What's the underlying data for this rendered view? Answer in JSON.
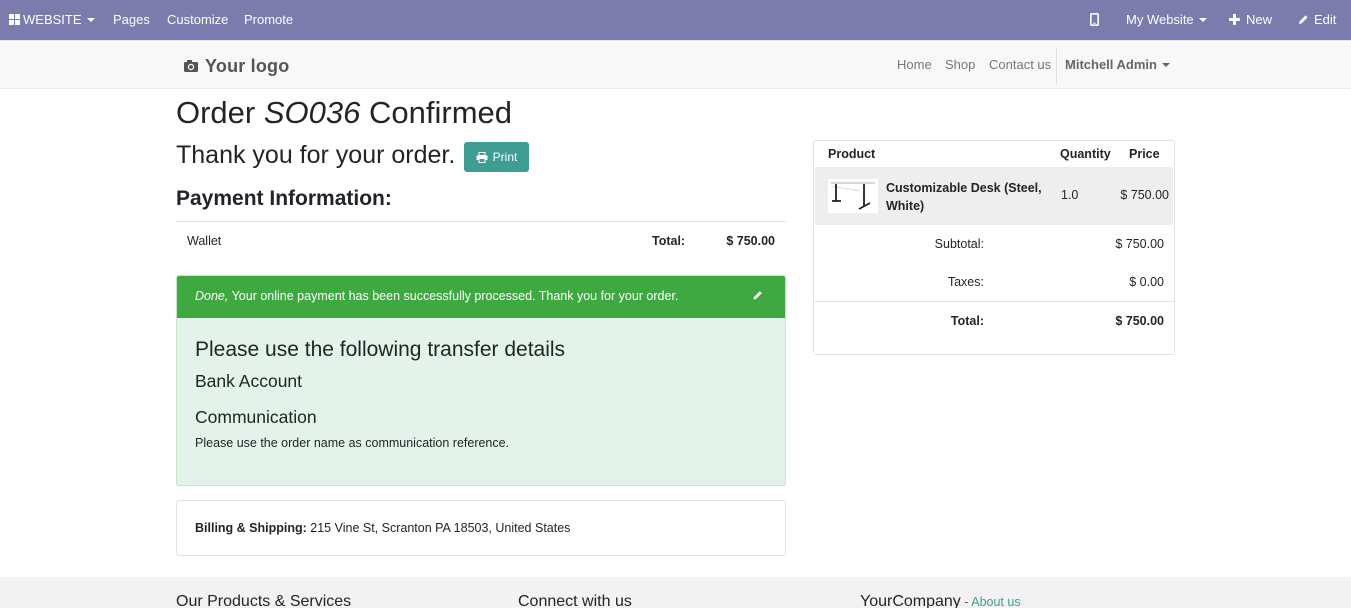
{
  "adminbar": {
    "website_label": "WEBSITE",
    "pages_label": "Pages",
    "customize_label": "Customize",
    "promote_label": "Promote",
    "mywebsite_label": "My Website",
    "new_label": "New",
    "edit_label": "Edit",
    "bg_color": "#7c7bad"
  },
  "header": {
    "logo_text": "Your logo",
    "nav": [
      "Home",
      "Shop",
      "Contact us"
    ],
    "user_label": "Mitchell Admin"
  },
  "order": {
    "title_prefix": "Order",
    "order_ref": "SO036",
    "title_suffix": "Confirmed",
    "thanks": "Thank you for your order.",
    "print_label": "Print",
    "payment_heading": "Payment Information:",
    "payment_method": "Wallet",
    "total_label": "Total:",
    "total_value": "$ 750.00"
  },
  "alert": {
    "status_word": "Done,",
    "message": "Your online payment has been successfully processed. Thank you for your order.",
    "transfer_heading": "Please use the following transfer details",
    "bank_account_label": "Bank Account",
    "communication_label": "Communication",
    "communication_note": "Please use the order name as communication reference.",
    "header_color": "#3ea940",
    "body_color": "#e4f3ea"
  },
  "billing": {
    "label": "Billing & Shipping:",
    "address": "215 Vine St, Scranton PA 18503, United States"
  },
  "summary": {
    "col_product": "Product",
    "col_quantity": "Quantity",
    "col_price": "Price",
    "items": [
      {
        "name": "Customizable Desk (Steel, White)",
        "quantity": "1.0",
        "price": "$ 750.00"
      }
    ],
    "subtotal_label": "Subtotal:",
    "subtotal_value": "$ 750.00",
    "taxes_label": "Taxes:",
    "taxes_value": "$ 0.00",
    "total_label": "Total:",
    "total_value": "$ 750.00"
  },
  "footer": {
    "col1": "Our Products & Services",
    "col2": "Connect with us",
    "col3": "YourCompany",
    "col3_sep": " - ",
    "col3_link": "About us"
  },
  "accent_color": "#3f9e94"
}
